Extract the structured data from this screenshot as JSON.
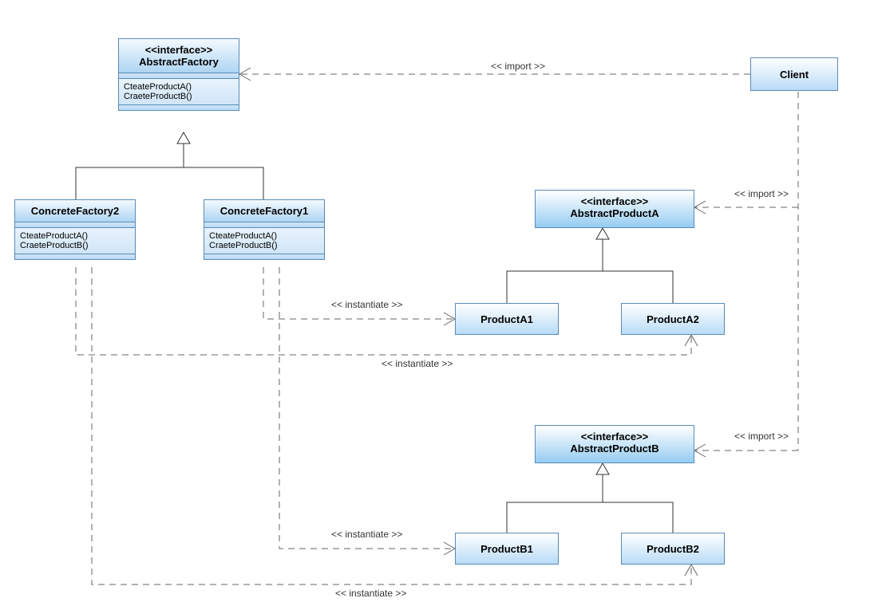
{
  "diagram_type": "UML Class Diagram",
  "pattern": "Abstract Factory",
  "stereotypes": {
    "interface": "<<interface>>",
    "import": "<< import >>",
    "instantiate": "<< instantiate >>"
  },
  "classes": {
    "abstractFactory": {
      "name": "AbstractFactory",
      "stereotype": "<<interface>>",
      "ops": [
        "CteateProductA()",
        "CraeteProductB()"
      ]
    },
    "concreteFactory1": {
      "name": "ConcreteFactory1",
      "ops": [
        "CteateProductA()",
        "CraeteProductB()"
      ]
    },
    "concreteFactory2": {
      "name": "ConcreteFactory2",
      "ops": [
        "CteateProductA()",
        "CraeteProductB()"
      ]
    },
    "abstractProductA": {
      "name": "AbstractProductA",
      "stereotype": "<<interface>>"
    },
    "abstractProductB": {
      "name": "AbstractProductB",
      "stereotype": "<<interface>>"
    },
    "productA1": {
      "name": "ProductA1"
    },
    "productA2": {
      "name": "ProductA2"
    },
    "productB1": {
      "name": "ProductB1"
    },
    "productB2": {
      "name": "ProductB2"
    },
    "client": {
      "name": "Client"
    }
  },
  "relations": [
    {
      "from": "Client",
      "to": "AbstractFactory",
      "type": "dependency",
      "stereotype": "import"
    },
    {
      "from": "Client",
      "to": "AbstractProductA",
      "type": "dependency",
      "stereotype": "import"
    },
    {
      "from": "Client",
      "to": "AbstractProductB",
      "type": "dependency",
      "stereotype": "import"
    },
    {
      "from": "ConcreteFactory1",
      "to": "AbstractFactory",
      "type": "realization"
    },
    {
      "from": "ConcreteFactory2",
      "to": "AbstractFactory",
      "type": "realization"
    },
    {
      "from": "ProductA1",
      "to": "AbstractProductA",
      "type": "generalization"
    },
    {
      "from": "ProductA2",
      "to": "AbstractProductA",
      "type": "generalization"
    },
    {
      "from": "ProductB1",
      "to": "AbstractProductB",
      "type": "generalization"
    },
    {
      "from": "ProductB2",
      "to": "AbstractProductB",
      "type": "generalization"
    },
    {
      "from": "ConcreteFactory1",
      "to": "ProductA1",
      "type": "dependency",
      "stereotype": "instantiate"
    },
    {
      "from": "ConcreteFactory1",
      "to": "ProductB1",
      "type": "dependency",
      "stereotype": "instantiate"
    },
    {
      "from": "ConcreteFactory2",
      "to": "ProductA2",
      "type": "dependency",
      "stereotype": "instantiate"
    },
    {
      "from": "ConcreteFactory2",
      "to": "ProductB2",
      "type": "dependency",
      "stereotype": "instantiate"
    }
  ]
}
